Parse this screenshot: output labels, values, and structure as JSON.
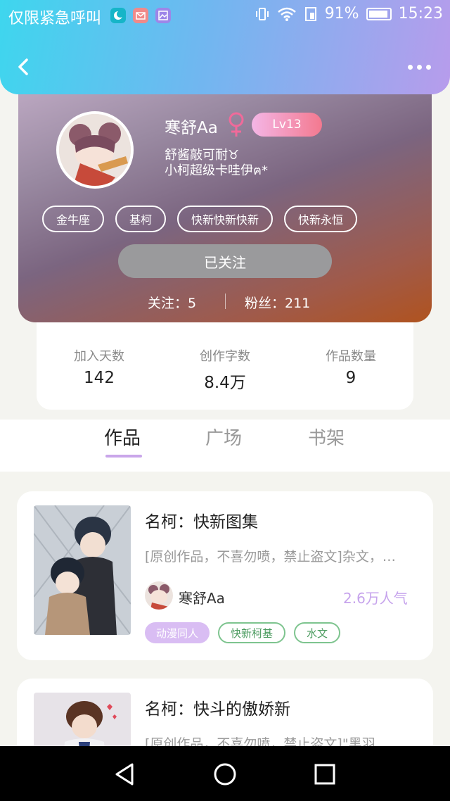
{
  "status_bar": {
    "carrier": "仅限紧急呼叫",
    "battery": "91%",
    "time": "15:23"
  },
  "profile": {
    "username": "寒舒Aa",
    "level": "Lv13",
    "signature": "舒酱敲可耐♉\n小柯超级卡哇伊ฅ*",
    "tags": [
      "金牛座",
      "基柯",
      "快新快新快新",
      "快新永恒"
    ],
    "follow_button": "已关注",
    "following": "关注：5",
    "followers": "粉丝：211"
  },
  "stats": [
    {
      "label": "加入天数",
      "value": "142"
    },
    {
      "label": "创作字数",
      "value": "8.4万"
    },
    {
      "label": "作品数量",
      "value": "9"
    }
  ],
  "tabs": [
    "作品",
    "广场",
    "书架"
  ],
  "works": [
    {
      "title": "名柯：快新图集",
      "desc": "[原创作品，不喜勿喷，禁止盗文]杂文，…",
      "author": "寒舒Aa",
      "popularity": "2.6万人气",
      "tags": [
        "动漫同人",
        "快新柯基",
        "水文"
      ]
    },
    {
      "title": "名柯：快斗的傲娇新",
      "desc": "[原创作品，不喜勿喷，禁止盗文]\"黑羽"
    }
  ],
  "colors": {
    "header_gradient_start": "#3ed6ee",
    "header_gradient_end": "#b79cec",
    "accent_purple": "#c9a6ea",
    "tag_green": "#7ec48f",
    "level_pink": "#f3798f"
  }
}
